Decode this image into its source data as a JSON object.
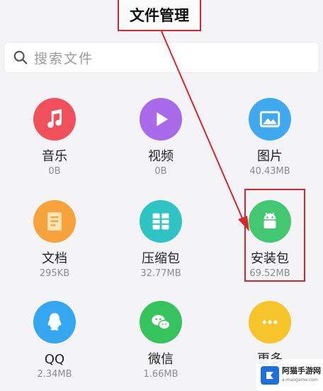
{
  "header": {
    "title": "文件管理"
  },
  "search": {
    "placeholder": "搜索文件"
  },
  "categories": [
    {
      "label": "音乐",
      "size": "0B",
      "icon": "music-note-icon",
      "color": "#f0505a"
    },
    {
      "label": "视频",
      "size": "0B",
      "icon": "play-icon",
      "color": "#a86ae8"
    },
    {
      "label": "图片",
      "size": "40.43MB",
      "icon": "image-icon",
      "color": "#3fa8ee"
    },
    {
      "label": "文档",
      "size": "295KB",
      "icon": "document-icon",
      "color": "#f7a23a"
    },
    {
      "label": "压缩包",
      "size": "32.77MB",
      "icon": "archive-icon",
      "color": "#2fc4c4"
    },
    {
      "label": "安装包",
      "size": "69.52MB",
      "icon": "android-icon",
      "color": "#43c871"
    },
    {
      "label": "QQ",
      "size": "2.34MB",
      "icon": "qq-icon",
      "color": "#35a6f0"
    },
    {
      "label": "微信",
      "size": "1.66MB",
      "icon": "wechat-icon",
      "color": "#36c25c"
    },
    {
      "label": "更多",
      "size": "",
      "icon": "more-icon",
      "color": "#f8c42c"
    }
  ],
  "watermark": {
    "text": "阿猫手游网",
    "sub": "a-maogame.com"
  },
  "colors": {
    "highlight": "#d9262c",
    "background": "#f4f4f6"
  }
}
